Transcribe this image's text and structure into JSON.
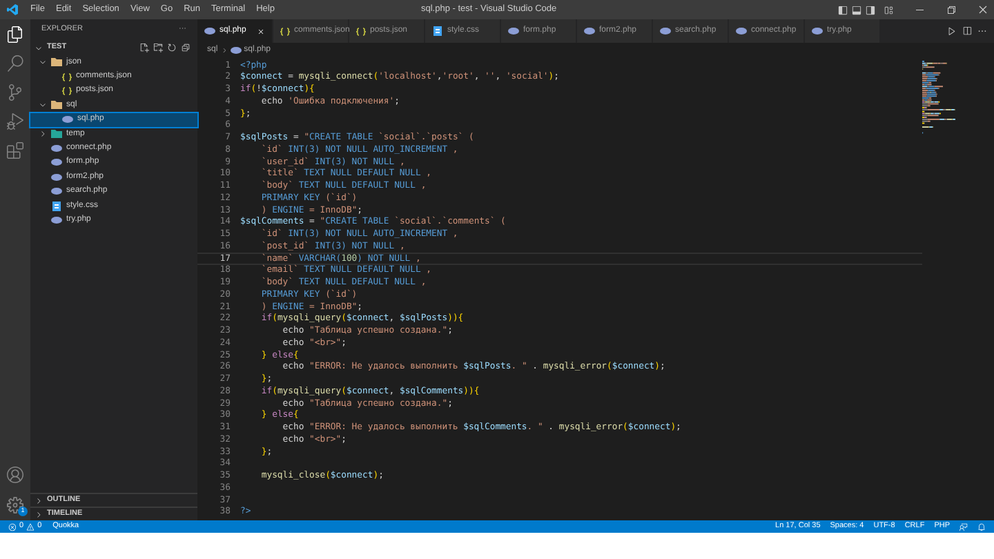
{
  "window": {
    "title": "sql.php - test - Visual Studio Code"
  },
  "menu": [
    "File",
    "Edit",
    "Selection",
    "View",
    "Go",
    "Run",
    "Terminal",
    "Help"
  ],
  "sidebar": {
    "title": "EXPLORER",
    "more": "···",
    "root": "TEST",
    "tree": [
      {
        "label": "json",
        "kind": "folder",
        "expanded": true,
        "selected": false,
        "children": [
          {
            "label": "comments.json",
            "kind": "json",
            "selected": false
          },
          {
            "label": "posts.json",
            "kind": "json",
            "selected": false
          }
        ]
      },
      {
        "label": "sql",
        "kind": "folder",
        "expanded": true,
        "selected": false,
        "children": [
          {
            "label": "sql.php",
            "kind": "php",
            "selected": true
          }
        ]
      },
      {
        "label": "temp",
        "kind": "folder-temp",
        "expanded": false,
        "selected": false
      },
      {
        "label": "connect.php",
        "kind": "php",
        "selected": false
      },
      {
        "label": "form.php",
        "kind": "php",
        "selected": false
      },
      {
        "label": "form2.php",
        "kind": "php",
        "selected": false
      },
      {
        "label": "search.php",
        "kind": "php",
        "selected": false
      },
      {
        "label": "style.css",
        "kind": "css",
        "selected": false
      },
      {
        "label": "try.php",
        "kind": "php",
        "selected": false
      }
    ],
    "panels": [
      "OUTLINE",
      "TIMELINE"
    ]
  },
  "settings_badge": "1",
  "tabs": [
    {
      "label": "sql.php",
      "kind": "php",
      "selected": true
    },
    {
      "label": "comments.json",
      "kind": "json",
      "selected": false
    },
    {
      "label": "posts.json",
      "kind": "json",
      "selected": false
    },
    {
      "label": "style.css",
      "kind": "css",
      "selected": false
    },
    {
      "label": "form.php",
      "kind": "php",
      "selected": false
    },
    {
      "label": "form2.php",
      "kind": "php",
      "selected": false
    },
    {
      "label": "search.php",
      "kind": "php",
      "selected": false
    },
    {
      "label": "connect.php",
      "kind": "php",
      "selected": false
    },
    {
      "label": "try.php",
      "kind": "php",
      "selected": false
    }
  ],
  "breadcrumb": [
    "sql",
    "sql.php"
  ],
  "code": [
    {
      "n": "1",
      "current": false,
      "tokens": [
        {
          "kind": "kw",
          "text": "<?php"
        }
      ]
    },
    {
      "n": "2",
      "current": false,
      "tokens": [
        {
          "kind": "var",
          "text": "$connect"
        },
        {
          "kind": "pl",
          "text": " = "
        },
        {
          "kind": "fn",
          "text": "mysqli_connect"
        },
        {
          "kind": "br",
          "text": "("
        },
        {
          "kind": "str",
          "text": "'localhost'"
        },
        {
          "kind": "pl",
          "text": ","
        },
        {
          "kind": "str",
          "text": "'root'"
        },
        {
          "kind": "pl",
          "text": ", "
        },
        {
          "kind": "str",
          "text": "''"
        },
        {
          "kind": "pl",
          "text": ", "
        },
        {
          "kind": "str",
          "text": "'social'"
        },
        {
          "kind": "br",
          "text": ")"
        },
        {
          "kind": "pl",
          "text": ";"
        }
      ]
    },
    {
      "n": "3",
      "current": false,
      "tokens": [
        {
          "kind": "ctl",
          "text": "if"
        },
        {
          "kind": "br",
          "text": "("
        },
        {
          "kind": "pl",
          "text": "!"
        },
        {
          "kind": "var",
          "text": "$connect"
        },
        {
          "kind": "br",
          "text": "){"
        }
      ]
    },
    {
      "n": "4",
      "current": false,
      "tokens": [
        {
          "kind": "pl",
          "text": "    echo "
        },
        {
          "kind": "str",
          "text": "'Ошибка подключения'"
        },
        {
          "kind": "pl",
          "text": ";"
        }
      ]
    },
    {
      "n": "5",
      "current": false,
      "tokens": [
        {
          "kind": "br",
          "text": "}"
        },
        {
          "kind": "pl",
          "text": ";"
        }
      ]
    },
    {
      "n": "6",
      "current": false
    },
    {
      "n": "7",
      "current": false,
      "tokens": [
        {
          "kind": "var",
          "text": "$sqlPosts"
        },
        {
          "kind": "pl",
          "text": " = "
        },
        {
          "kind": "str",
          "text": "\""
        },
        {
          "kind": "kw",
          "text": "CREATE TABLE "
        },
        {
          "kind": "str",
          "text": "`social`.`posts` ("
        }
      ]
    },
    {
      "n": "8",
      "current": false,
      "tokens": [
        {
          "kind": "str",
          "text": "    `id` "
        },
        {
          "kind": "kw",
          "text": "INT(3) NOT NULL AUTO_INCREMENT"
        },
        {
          "kind": "str",
          "text": " ,"
        }
      ]
    },
    {
      "n": "9",
      "current": false,
      "tokens": [
        {
          "kind": "str",
          "text": "    `user_id` "
        },
        {
          "kind": "kw",
          "text": "INT(3) NOT NULL"
        },
        {
          "kind": "str",
          "text": " ,"
        }
      ]
    },
    {
      "n": "10",
      "current": false,
      "tokens": [
        {
          "kind": "str",
          "text": "    `title` "
        },
        {
          "kind": "kw",
          "text": "TEXT NULL DEFAULT NULL"
        },
        {
          "kind": "str",
          "text": " ,"
        }
      ]
    },
    {
      "n": "11",
      "current": false,
      "tokens": [
        {
          "kind": "str",
          "text": "    `body` "
        },
        {
          "kind": "kw",
          "text": "TEXT NULL DEFAULT NULL"
        },
        {
          "kind": "str",
          "text": " ,"
        }
      ]
    },
    {
      "n": "12",
      "current": false,
      "tokens": [
        {
          "kind": "kw",
          "text": "    PRIMARY KEY "
        },
        {
          "kind": "str",
          "text": "(`id`)"
        }
      ]
    },
    {
      "n": "13",
      "current": false,
      "tokens": [
        {
          "kind": "str",
          "text": "    ) "
        },
        {
          "kind": "kw",
          "text": "ENGINE"
        },
        {
          "kind": "str",
          "text": " = InnoDB\""
        },
        {
          "kind": "pl",
          "text": ";"
        }
      ]
    },
    {
      "n": "14",
      "current": false,
      "tokens": [
        {
          "kind": "var",
          "text": "$sqlComments"
        },
        {
          "kind": "pl",
          "text": " = "
        },
        {
          "kind": "str",
          "text": "\""
        },
        {
          "kind": "kw",
          "text": "CREATE TABLE "
        },
        {
          "kind": "str",
          "text": "`social`.`comments` ("
        }
      ]
    },
    {
      "n": "15",
      "current": false,
      "tokens": [
        {
          "kind": "str",
          "text": "    `id` "
        },
        {
          "kind": "kw",
          "text": "INT(3) NOT NULL AUTO_INCREMENT"
        },
        {
          "kind": "str",
          "text": " ,"
        }
      ]
    },
    {
      "n": "16",
      "current": false,
      "tokens": [
        {
          "kind": "str",
          "text": "    `post_id` "
        },
        {
          "kind": "kw",
          "text": "INT(3) NOT NULL"
        },
        {
          "kind": "str",
          "text": " ,"
        }
      ]
    },
    {
      "n": "17",
      "current": true,
      "tokens": [
        {
          "kind": "str",
          "text": "    `name` "
        },
        {
          "kind": "kw",
          "text": "VARCHAR("
        },
        {
          "kind": "num",
          "text": "100"
        },
        {
          "kind": "kw",
          "text": ") NOT NULL"
        },
        {
          "kind": "str",
          "text": " ,"
        }
      ]
    },
    {
      "n": "18",
      "current": false,
      "tokens": [
        {
          "kind": "str",
          "text": "    `email` "
        },
        {
          "kind": "kw",
          "text": "TEXT NULL DEFAULT NULL"
        },
        {
          "kind": "str",
          "text": " ,"
        }
      ]
    },
    {
      "n": "19",
      "current": false,
      "tokens": [
        {
          "kind": "str",
          "text": "    `body` "
        },
        {
          "kind": "kw",
          "text": "TEXT NULL DEFAULT NULL"
        },
        {
          "kind": "str",
          "text": " ,"
        }
      ]
    },
    {
      "n": "20",
      "current": false,
      "tokens": [
        {
          "kind": "kw",
          "text": "    PRIMARY KEY "
        },
        {
          "kind": "str",
          "text": "(`id`)"
        }
      ]
    },
    {
      "n": "21",
      "current": false,
      "tokens": [
        {
          "kind": "str",
          "text": "    ) "
        },
        {
          "kind": "kw",
          "text": "ENGINE"
        },
        {
          "kind": "str",
          "text": " = InnoDB\""
        },
        {
          "kind": "pl",
          "text": ";"
        }
      ]
    },
    {
      "n": "22",
      "current": false,
      "tokens": [
        {
          "kind": "ctl",
          "text": "    if"
        },
        {
          "kind": "br",
          "text": "("
        },
        {
          "kind": "fn",
          "text": "mysqli_query"
        },
        {
          "kind": "br",
          "text": "("
        },
        {
          "kind": "var",
          "text": "$connect"
        },
        {
          "kind": "pl",
          "text": ", "
        },
        {
          "kind": "var",
          "text": "$sqlPosts"
        },
        {
          "kind": "br",
          "text": ")){"
        }
      ]
    },
    {
      "n": "23",
      "current": false,
      "tokens": [
        {
          "kind": "pl",
          "text": "        echo "
        },
        {
          "kind": "str",
          "text": "\"Таблица успешно создана.\""
        },
        {
          "kind": "pl",
          "text": ";"
        }
      ]
    },
    {
      "n": "24",
      "current": false,
      "tokens": [
        {
          "kind": "pl",
          "text": "        echo "
        },
        {
          "kind": "str",
          "text": "\"<br>\""
        },
        {
          "kind": "pl",
          "text": ";"
        }
      ]
    },
    {
      "n": "25",
      "current": false,
      "tokens": [
        {
          "kind": "br",
          "text": "    }"
        },
        {
          "kind": "ctl",
          "text": " else"
        },
        {
          "kind": "br",
          "text": "{"
        }
      ]
    },
    {
      "n": "26",
      "current": false,
      "tokens": [
        {
          "kind": "pl",
          "text": "        echo "
        },
        {
          "kind": "str",
          "text": "\"ERROR: Не удалось выполнить "
        },
        {
          "kind": "var",
          "text": "$sqlPosts"
        },
        {
          "kind": "str",
          "text": ". \""
        },
        {
          "kind": "pl",
          "text": " . "
        },
        {
          "kind": "fn",
          "text": "mysqli_error"
        },
        {
          "kind": "br",
          "text": "("
        },
        {
          "kind": "var",
          "text": "$connect"
        },
        {
          "kind": "br",
          "text": ")"
        },
        {
          "kind": "pl",
          "text": ";"
        }
      ]
    },
    {
      "n": "27",
      "current": false,
      "tokens": [
        {
          "kind": "br",
          "text": "    }"
        },
        {
          "kind": "pl",
          "text": ";"
        }
      ]
    },
    {
      "n": "28",
      "current": false,
      "tokens": [
        {
          "kind": "ctl",
          "text": "    if"
        },
        {
          "kind": "br",
          "text": "("
        },
        {
          "kind": "fn",
          "text": "mysqli_query"
        },
        {
          "kind": "br",
          "text": "("
        },
        {
          "kind": "var",
          "text": "$connect"
        },
        {
          "kind": "pl",
          "text": ", "
        },
        {
          "kind": "var",
          "text": "$sqlComments"
        },
        {
          "kind": "br",
          "text": ")){"
        }
      ]
    },
    {
      "n": "29",
      "current": false,
      "tokens": [
        {
          "kind": "pl",
          "text": "        echo "
        },
        {
          "kind": "str",
          "text": "\"Таблица успешно создана.\""
        },
        {
          "kind": "pl",
          "text": ";"
        }
      ]
    },
    {
      "n": "30",
      "current": false,
      "tokens": [
        {
          "kind": "br",
          "text": "    }"
        },
        {
          "kind": "ctl",
          "text": " else"
        },
        {
          "kind": "br",
          "text": "{"
        }
      ]
    },
    {
      "n": "31",
      "current": false,
      "tokens": [
        {
          "kind": "pl",
          "text": "        echo "
        },
        {
          "kind": "str",
          "text": "\"ERROR: Не удалось выполнить "
        },
        {
          "kind": "var",
          "text": "$sqlComments"
        },
        {
          "kind": "str",
          "text": ". \""
        },
        {
          "kind": "pl",
          "text": " . "
        },
        {
          "kind": "fn",
          "text": "mysqli_error"
        },
        {
          "kind": "br",
          "text": "("
        },
        {
          "kind": "var",
          "text": "$connect"
        },
        {
          "kind": "br",
          "text": ")"
        },
        {
          "kind": "pl",
          "text": ";"
        }
      ]
    },
    {
      "n": "32",
      "current": false,
      "tokens": [
        {
          "kind": "pl",
          "text": "        echo "
        },
        {
          "kind": "str",
          "text": "\"<br>\""
        },
        {
          "kind": "pl",
          "text": ";"
        }
      ]
    },
    {
      "n": "33",
      "current": false,
      "tokens": [
        {
          "kind": "br",
          "text": "    }"
        },
        {
          "kind": "pl",
          "text": ";"
        }
      ]
    },
    {
      "n": "34",
      "current": false
    },
    {
      "n": "35",
      "current": false,
      "tokens": [
        {
          "kind": "fn",
          "text": "    mysqli_close"
        },
        {
          "kind": "br",
          "text": "("
        },
        {
          "kind": "var",
          "text": "$connect"
        },
        {
          "kind": "br",
          "text": ")"
        },
        {
          "kind": "pl",
          "text": ";"
        }
      ]
    },
    {
      "n": "36",
      "current": false
    },
    {
      "n": "37",
      "current": false
    },
    {
      "n": "38",
      "current": false,
      "tokens": [
        {
          "kind": "kw",
          "text": "?>"
        }
      ]
    }
  ],
  "status_bar": {
    "errors": "0",
    "warnings": "0",
    "left": [
      "Quokka"
    ],
    "right": [
      "Ln 17, Col 35",
      "Spaces: 4",
      "UTF-8",
      "CRLF",
      "PHP"
    ]
  }
}
